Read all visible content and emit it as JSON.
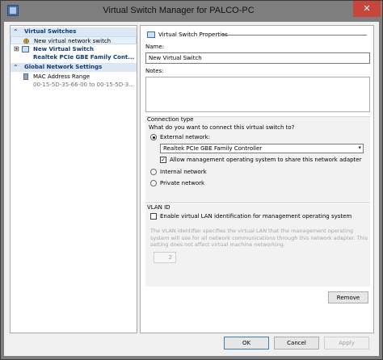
{
  "window": {
    "title": "Virtual Switch Manager for PALCO-PC",
    "close_glyph": "✕"
  },
  "left_pane": {
    "virtual_switches_header": "Virtual Switches",
    "new_network_switch": "New virtual network switch",
    "new_switch_name": "New Virtual Switch",
    "new_switch_adapter": "Realtek PCIe GBE Family Cont...",
    "global_settings_header": "Global Network Settings",
    "mac_range_label": "MAC Address Range",
    "mac_range_value": "00-15-5D-35-66-00 to 00-15-5D-3..."
  },
  "properties": {
    "header": "Virtual Switch Properties",
    "name_label": "Name:",
    "name_value": "New Virtual Switch",
    "notes_label": "Notes:",
    "connection_type_label": "Connection type",
    "connection_question": "What do you want to connect this virtual switch to?",
    "external_label": "External network:",
    "adapter_selected": "Realtek PCIe GBE Family Controller",
    "allow_mgmt_label": "Allow management operating system to share this network adapter",
    "internal_label": "Internal network",
    "private_label": "Private network",
    "vlan_header": "VLAN ID",
    "vlan_enable_label": "Enable virtual LAN identification for management operating system",
    "vlan_desc_1": "The VLAN identifier specifies the virtual LAN that the management operating",
    "vlan_desc_2": "system will use for all network communications through this network adapter. This",
    "vlan_desc_3": "setting does not affect virtual machine networking.",
    "vlan_value": "2",
    "remove_button": "Remove"
  },
  "footer": {
    "ok": "OK",
    "cancel": "Cancel",
    "apply": "Apply"
  },
  "colors": {
    "section_header_text": "#0d3a78",
    "section_header_bg": "#dde7f3",
    "selection_bg": "#e5f0fb",
    "close_button": "#c7463a"
  },
  "icons": {
    "collapse": "chevron-up-icon",
    "expand": "plus-icon",
    "switch": "network-switch-icon",
    "mac": "mac-address-icon",
    "dropdown": "chevron-down-icon"
  }
}
